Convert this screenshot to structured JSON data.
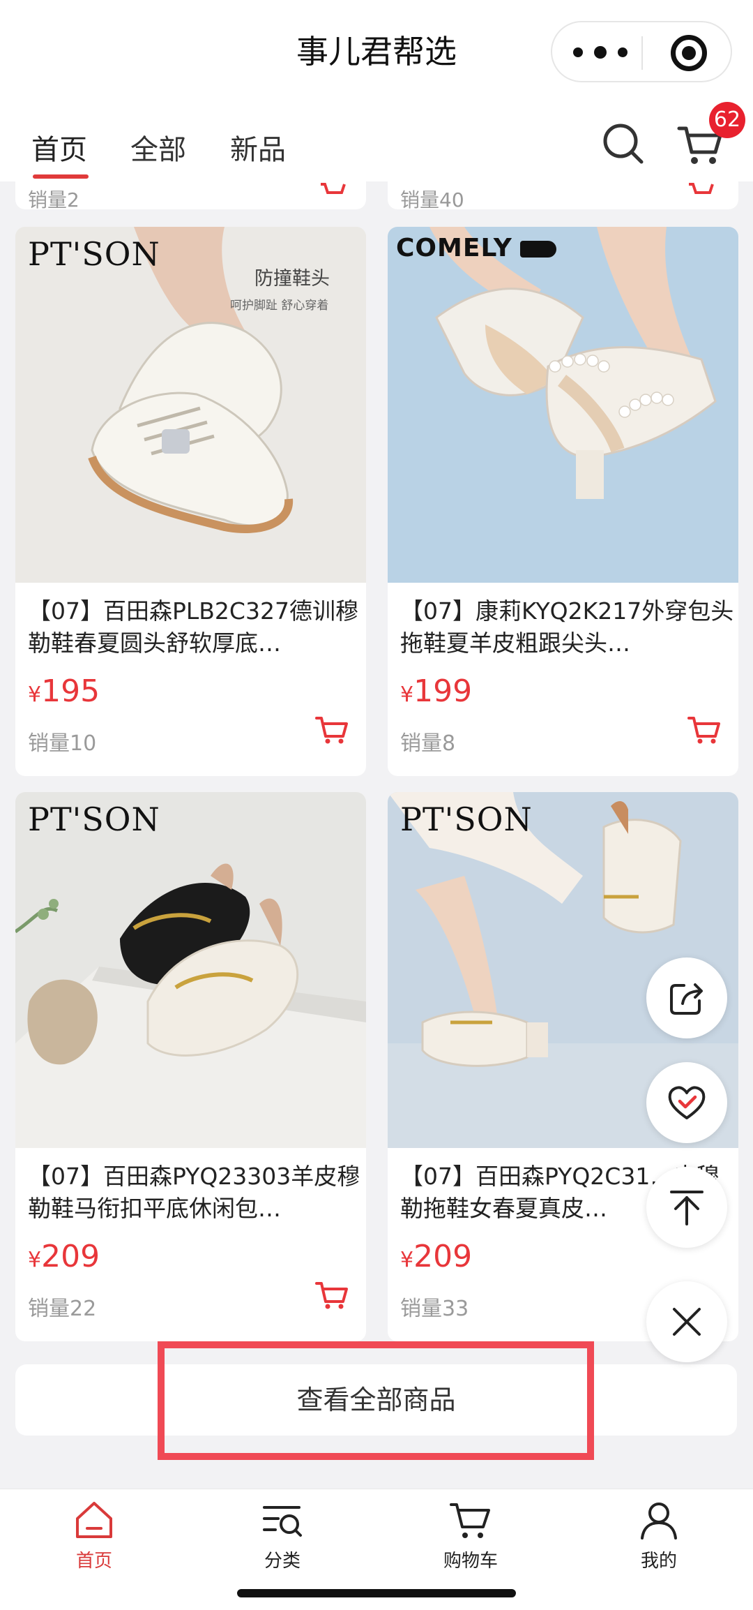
{
  "app": {
    "title": "事儿君帮选"
  },
  "tabs": [
    {
      "label": "首页",
      "active": true
    },
    {
      "label": "全部",
      "active": false
    },
    {
      "label": "新品",
      "active": false
    }
  ],
  "cart_badge": "62",
  "partial_row": [
    {
      "sales": "销量2"
    },
    {
      "sales": "销量40"
    }
  ],
  "products": [
    {
      "name": "【07】百田森PLB2C327德训穆勒鞋春夏圆头舒软厚底…",
      "currency": "¥",
      "price": "195",
      "sales": "销量10",
      "brand": "PT'SON",
      "image_caption": "防撞鞋头",
      "image_subcaption": "呵护脚趾 舒心穿着"
    },
    {
      "name": "【07】康莉KYQ2K217外穿包头拖鞋夏羊皮粗跟尖头…",
      "currency": "¥",
      "price": "199",
      "sales": "销量8",
      "brand": "COMELY"
    },
    {
      "name": "【07】百田森PYQ23303羊皮穆勒鞋马衔扣平底休闲包…",
      "currency": "¥",
      "price": "209",
      "sales": "销量22",
      "brand": "PT'SON"
    },
    {
      "name": "【07】百田森PYQ2C31…皮穆勒拖鞋女春夏真皮…",
      "currency": "¥",
      "price": "209",
      "sales": "销量33",
      "brand": "PT'SON"
    }
  ],
  "view_all_label": "查看全部商品",
  "bottom_nav": [
    {
      "label": "首页",
      "icon": "home-icon",
      "active": true
    },
    {
      "label": "分类",
      "icon": "category-icon",
      "active": false
    },
    {
      "label": "购物车",
      "icon": "cart-icon",
      "active": false
    },
    {
      "label": "我的",
      "icon": "user-icon",
      "active": false
    }
  ],
  "colors": {
    "accent": "#e8363a",
    "badge": "#e8212e",
    "highlight": "#f04a55"
  }
}
